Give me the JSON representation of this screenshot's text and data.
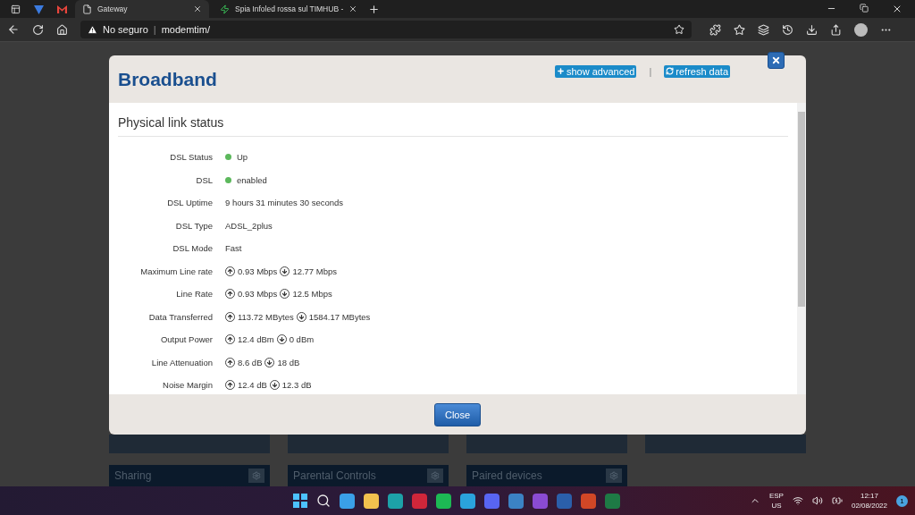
{
  "browser": {
    "tabs": [
      {
        "title": "Gateway",
        "selected": true
      },
      {
        "title": "Spia Infoled rossa sul TIMHUB - ",
        "selected": false
      }
    ],
    "security": "No seguro",
    "url_separator": "|",
    "url": "modemtim/"
  },
  "modal": {
    "title": "Broadband",
    "actions": [
      {
        "label": "show advanced",
        "kind": "plus"
      },
      {
        "label": "refresh data",
        "kind": "refresh"
      }
    ],
    "separator": "|",
    "section": "Physical link status",
    "rows": [
      {
        "label": "DSL Status",
        "kind": "status",
        "value": "Up",
        "color": "#5cb85c"
      },
      {
        "label": "DSL",
        "kind": "status",
        "value": "enabled",
        "color": "#5cb85c"
      },
      {
        "label": "DSL Uptime",
        "kind": "text",
        "value": "9 hours 31 minutes 30 seconds"
      },
      {
        "label": "DSL Type",
        "kind": "text",
        "value": "ADSL_2plus"
      },
      {
        "label": "DSL Mode",
        "kind": "text",
        "value": "Fast"
      },
      {
        "label": "Maximum Line rate",
        "kind": "updown",
        "up": "0.93 Mbps",
        "down": "12.77 Mbps"
      },
      {
        "label": "Line Rate",
        "kind": "updown",
        "up": "0.93 Mbps",
        "down": "12.5 Mbps"
      },
      {
        "label": "Data Transferred",
        "kind": "updown",
        "up": "113.72 MBytes",
        "down": "1584.17 MBytes"
      },
      {
        "label": "Output Power",
        "kind": "updown",
        "up": "12.4 dBm",
        "down": "0 dBm"
      },
      {
        "label": "Line Attenuation",
        "kind": "updown",
        "up": "8.6 dB",
        "down": "18 dB"
      },
      {
        "label": "Noise Margin",
        "kind": "updown",
        "up": "12.4 dB",
        "down": "12.3 dB"
      }
    ],
    "close": "Close"
  },
  "cards": [
    "Sharing",
    "Parental Controls",
    "Paired devices"
  ],
  "tray": {
    "lang": "ESP",
    "region": "US",
    "time": "12:17",
    "date": "02/08/2022",
    "notifications": "1"
  }
}
